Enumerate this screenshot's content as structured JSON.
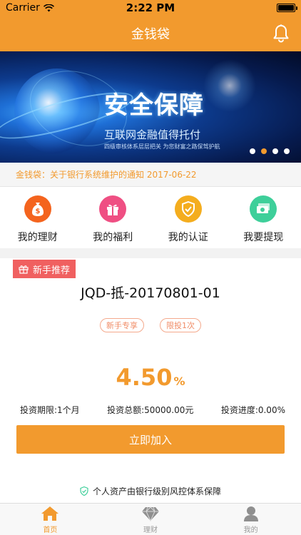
{
  "status_bar": {
    "carrier": "Carrier",
    "time": "2:22 PM"
  },
  "nav": {
    "title": "金钱袋"
  },
  "banner": {
    "headline": "安全保障",
    "subtitle": "互联网金融值得托付",
    "caption": "四级审核体系层层把关 为您财富之路保驾护航",
    "slide_count": 4,
    "active_slide": 2
  },
  "notice": {
    "text": "金钱袋：关于银行系统维护的通知 2017-06-22"
  },
  "quick_actions": [
    {
      "label": "我的理财",
      "icon": "money-bag-icon",
      "color": "#f4641e",
      "glyph": "$"
    },
    {
      "label": "我的福利",
      "icon": "gift-icon",
      "color": "#ef4f83",
      "glyph": "🎁"
    },
    {
      "label": "我的认证",
      "icon": "shield-check-icon",
      "color": "#f4ad1e",
      "glyph": "✓"
    },
    {
      "label": "我要提现",
      "icon": "cash-icon",
      "color": "#3ecf9a",
      "glyph": "¥"
    }
  ],
  "product": {
    "tag": "新手推荐",
    "name": "JQD-抵-20170801-01",
    "badges": [
      "新手专享",
      "限投1次"
    ],
    "rate_value": "4.50",
    "rate_unit": "%",
    "term": "投资期限:1个月",
    "total": "投资总额:50000.00元",
    "progress": "投资进度:0.00%",
    "progress_value": 0,
    "join_label": "立即加入",
    "safety_note": "个人资产由银行级别风控体系保障"
  },
  "tabs": [
    {
      "label": "首页",
      "icon": "home-icon",
      "active": true
    },
    {
      "label": "理财",
      "icon": "diamond-icon",
      "active": false
    },
    {
      "label": "我的",
      "icon": "user-icon",
      "active": false
    }
  ],
  "colors": {
    "accent": "#f29a2e",
    "tag": "#f06060"
  }
}
